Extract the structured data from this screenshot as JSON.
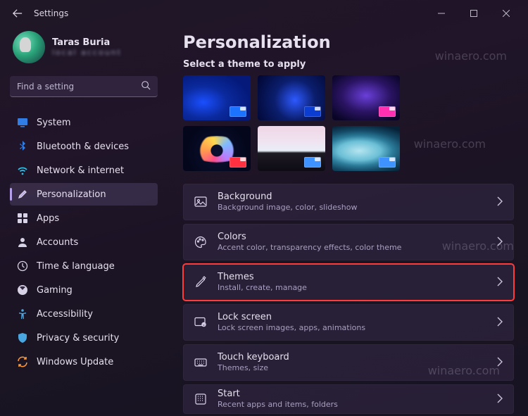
{
  "window": {
    "title": "Settings"
  },
  "profile": {
    "name": "Taras Buria",
    "sub": "local account"
  },
  "search": {
    "placeholder": "Find a setting"
  },
  "nav": [
    {
      "key": "system",
      "label": "System",
      "selected": false
    },
    {
      "key": "bluetooth",
      "label": "Bluetooth & devices",
      "selected": false
    },
    {
      "key": "network",
      "label": "Network & internet",
      "selected": false
    },
    {
      "key": "personalization",
      "label": "Personalization",
      "selected": true
    },
    {
      "key": "apps",
      "label": "Apps",
      "selected": false
    },
    {
      "key": "accounts",
      "label": "Accounts",
      "selected": false
    },
    {
      "key": "time",
      "label": "Time & language",
      "selected": false
    },
    {
      "key": "gaming",
      "label": "Gaming",
      "selected": false
    },
    {
      "key": "accessibility",
      "label": "Accessibility",
      "selected": false
    },
    {
      "key": "privacy",
      "label": "Privacy & security",
      "selected": false
    },
    {
      "key": "update",
      "label": "Windows Update",
      "selected": false
    }
  ],
  "page": {
    "title": "Personalization",
    "themeHeading": "Select a theme to apply"
  },
  "themes": {
    "colors": [
      "#1c73ff",
      "#0c3dd1",
      "#ff2fb2",
      "#ff3040",
      "#3f93ff",
      "#3f93ff"
    ]
  },
  "settings": [
    {
      "key": "background",
      "title": "Background",
      "desc": "Background image, color, slideshow",
      "highlight": false
    },
    {
      "key": "colors",
      "title": "Colors",
      "desc": "Accent color, transparency effects, color theme",
      "highlight": false
    },
    {
      "key": "themes",
      "title": "Themes",
      "desc": "Install, create, manage",
      "highlight": true
    },
    {
      "key": "lockscreen",
      "title": "Lock screen",
      "desc": "Lock screen images, apps, animations",
      "highlight": false
    },
    {
      "key": "touchkeyboard",
      "title": "Touch keyboard",
      "desc": "Themes, size",
      "highlight": false
    },
    {
      "key": "start",
      "title": "Start",
      "desc": "Recent apps and items, folders",
      "highlight": false
    }
  ],
  "watermark": "winaero.com"
}
